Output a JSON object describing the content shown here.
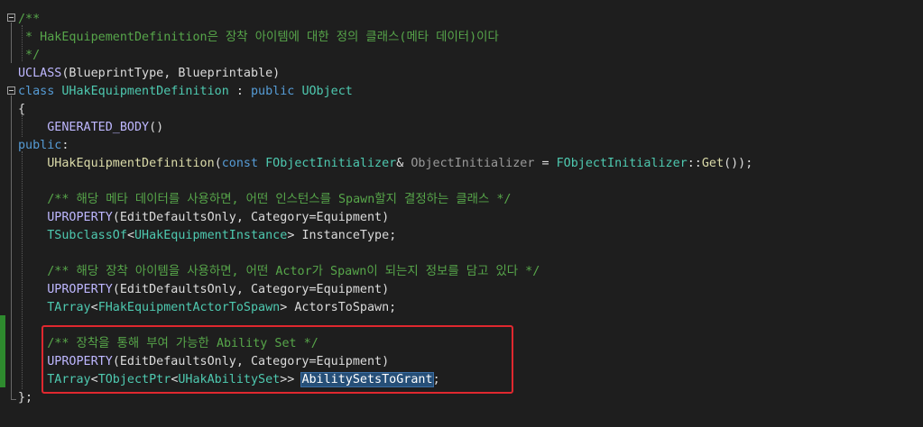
{
  "editor": {
    "lines": [
      [
        {
          "t": "/**",
          "c": "com"
        }
      ],
      [
        {
          "t": " * HakEquipementDefinition은 장착 아이템에 대한 정의 클래스(메타 데이터)이다",
          "c": "com"
        }
      ],
      [
        {
          "t": " */",
          "c": "com"
        }
      ],
      [
        {
          "t": "UCLASS",
          "c": "macro"
        },
        {
          "t": "(BlueprintType, Blueprintable)",
          "c": "plain"
        }
      ],
      [
        {
          "t": "class ",
          "c": "kw"
        },
        {
          "t": "UHakEquipmentDefinition",
          "c": "type"
        },
        {
          "t": " : ",
          "c": "plain"
        },
        {
          "t": "public ",
          "c": "kw"
        },
        {
          "t": "UObject",
          "c": "type"
        }
      ],
      [
        {
          "t": "{",
          "c": "plain"
        }
      ],
      [
        {
          "t": "    ",
          "c": "plain"
        },
        {
          "t": "GENERATED_BODY",
          "c": "macro"
        },
        {
          "t": "()",
          "c": "plain"
        }
      ],
      [
        {
          "t": "public",
          "c": "kw"
        },
        {
          "t": ":",
          "c": "plain"
        }
      ],
      [
        {
          "t": "    ",
          "c": "plain"
        },
        {
          "t": "UHakEquipmentDefinition",
          "c": "func"
        },
        {
          "t": "(",
          "c": "plain"
        },
        {
          "t": "const ",
          "c": "kw"
        },
        {
          "t": "FObjectInitializer",
          "c": "type"
        },
        {
          "t": "& ",
          "c": "plain"
        },
        {
          "t": "ObjectInitializer",
          "c": "param"
        },
        {
          "t": " = ",
          "c": "plain"
        },
        {
          "t": "FObjectInitializer",
          "c": "type"
        },
        {
          "t": "::",
          "c": "plain"
        },
        {
          "t": "Get",
          "c": "func"
        },
        {
          "t": "());",
          "c": "plain"
        }
      ],
      [],
      [
        {
          "t": "    ",
          "c": "plain"
        },
        {
          "t": "/** 해당 메타 데이터를 사용하면, 어떤 인스턴스를 Spawn할지 결정하는 클래스 */",
          "c": "com"
        }
      ],
      [
        {
          "t": "    ",
          "c": "plain"
        },
        {
          "t": "UPROPERTY",
          "c": "macro"
        },
        {
          "t": "(EditDefaultsOnly, Category=Equipment)",
          "c": "plain"
        }
      ],
      [
        {
          "t": "    ",
          "c": "plain"
        },
        {
          "t": "TSubclassOf",
          "c": "type"
        },
        {
          "t": "<",
          "c": "plain"
        },
        {
          "t": "UHakEquipmentInstance",
          "c": "type"
        },
        {
          "t": "> ",
          "c": "plain"
        },
        {
          "t": "InstanceType",
          "c": "id"
        },
        {
          "t": ";",
          "c": "plain"
        }
      ],
      [],
      [
        {
          "t": "    ",
          "c": "plain"
        },
        {
          "t": "/** 해당 장착 아이템을 사용하면, 어떤 Actor가 Spawn이 되는지 정보를 담고 있다 */",
          "c": "com"
        }
      ],
      [
        {
          "t": "    ",
          "c": "plain"
        },
        {
          "t": "UPROPERTY",
          "c": "macro"
        },
        {
          "t": "(EditDefaultsOnly, Category=Equipment)",
          "c": "plain"
        }
      ],
      [
        {
          "t": "    ",
          "c": "plain"
        },
        {
          "t": "TArray",
          "c": "type"
        },
        {
          "t": "<",
          "c": "plain"
        },
        {
          "t": "FHakEquipmentActorToSpawn",
          "c": "type"
        },
        {
          "t": "> ",
          "c": "plain"
        },
        {
          "t": "ActorsToSpawn",
          "c": "id"
        },
        {
          "t": ";",
          "c": "plain"
        }
      ],
      [],
      [
        {
          "t": "    ",
          "c": "plain"
        },
        {
          "t": "/** 장착을 통해 부여 가능한 Ability Set */",
          "c": "com"
        }
      ],
      [
        {
          "t": "    ",
          "c": "plain"
        },
        {
          "t": "UPROPERTY",
          "c": "macro"
        },
        {
          "t": "(EditDefaultsOnly, Category=Equipment)",
          "c": "plain"
        }
      ],
      [
        {
          "t": "    ",
          "c": "plain"
        },
        {
          "t": "TArray",
          "c": "type"
        },
        {
          "t": "<",
          "c": "plain"
        },
        {
          "t": "TObjectPtr",
          "c": "type"
        },
        {
          "t": "<",
          "c": "plain"
        },
        {
          "t": "UHakAbilitySet",
          "c": "type"
        },
        {
          "t": ">> ",
          "c": "plain"
        },
        {
          "t": "AbilitySetsToGrant",
          "c": "id",
          "sel": true
        },
        {
          "t": ";",
          "c": "plain"
        }
      ],
      [
        {
          "t": "};",
          "c": "plain"
        }
      ]
    ]
  },
  "colors": {
    "background": "#1e1e1e",
    "comment": "#57a64a",
    "keyword": "#569cd6",
    "type": "#4ec9b0",
    "macro": "#beb7ff",
    "function": "#dcdcaa",
    "highlight_box": "#e0282f",
    "selection": "#264f78"
  }
}
